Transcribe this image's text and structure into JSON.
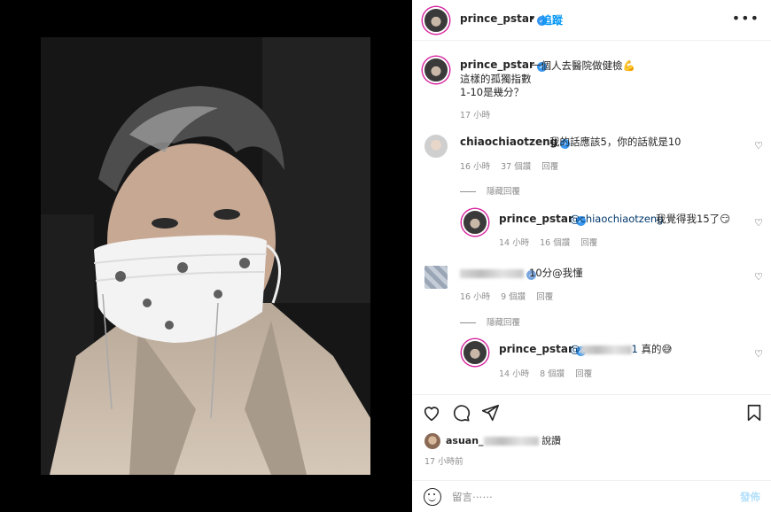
{
  "post": {
    "author": "prince_pstar",
    "follow_label": "追蹤",
    "dot": "•",
    "more_icon": "more-horizontal-icon",
    "caption_line1": "一個人去醫院做健檢💪",
    "caption_line2": "這樣的孤獨指數",
    "caption_line3": "1-10是幾分？",
    "caption_time": "17 小時"
  },
  "comments": [
    {
      "user": "chiaochiaotzeng",
      "text": "我的話應該5，你的話就是10",
      "time": "16 小時",
      "likes": "37 個讚",
      "reply": "回覆",
      "hide_replies": "隱藏回覆",
      "replies": [
        {
          "user": "prince_pstar",
          "mention": "@chiaochiaotzeng",
          "text": "我覺得我15了😏",
          "time": "14 小時",
          "likes": "16 個讚",
          "reply": "回覆"
        }
      ]
    },
    {
      "user": "",
      "text": "10分@我懂",
      "time": "16 小時",
      "likes": "9 個讚",
      "reply": "回覆",
      "hide_replies": "隱藏回覆",
      "replies": [
        {
          "user": "prince_pstar",
          "mention": "@",
          "mention_tail": "1",
          "text": "真的😅",
          "time": "14 小時",
          "likes": "8 個讚",
          "reply": "回覆"
        }
      ]
    }
  ],
  "likes_summary": {
    "name_prefix": "asuan_",
    "suffix": "說讚",
    "time": "17 小時前"
  },
  "comment_input": {
    "placeholder": "留言⋯⋯",
    "post_label": "發佈"
  },
  "colors": {
    "accent": "#0095f6",
    "verified": "#3897f0",
    "muted": "#8e8e8e"
  }
}
